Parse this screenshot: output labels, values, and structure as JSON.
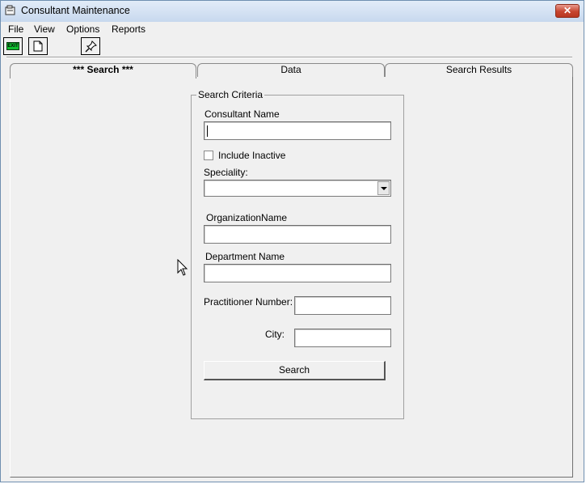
{
  "window": {
    "title": "Consultant Maintenance",
    "close_glyph": "✕"
  },
  "menu": [
    "File",
    "View",
    "Options",
    "Reports"
  ],
  "toolbar": {
    "exit_label": "EXIT"
  },
  "tabs": [
    "*** Search ***",
    "Data",
    "Search Results"
  ],
  "search": {
    "group_title": "Search Criteria",
    "consultant_name_label": "Consultant Name",
    "consultant_name_value": "",
    "include_inactive_label": "Include Inactive",
    "include_inactive_checked": false,
    "speciality_label": "Speciality:",
    "speciality_value": "",
    "organization_name_label": "OrganizationName",
    "organization_name_value": "",
    "department_name_label": "Department Name",
    "department_name_value": "",
    "practitioner_number_label": "Practitioner Number:",
    "practitioner_number_value": "",
    "city_label": "City:",
    "city_value": "",
    "search_button_label": "Search"
  }
}
